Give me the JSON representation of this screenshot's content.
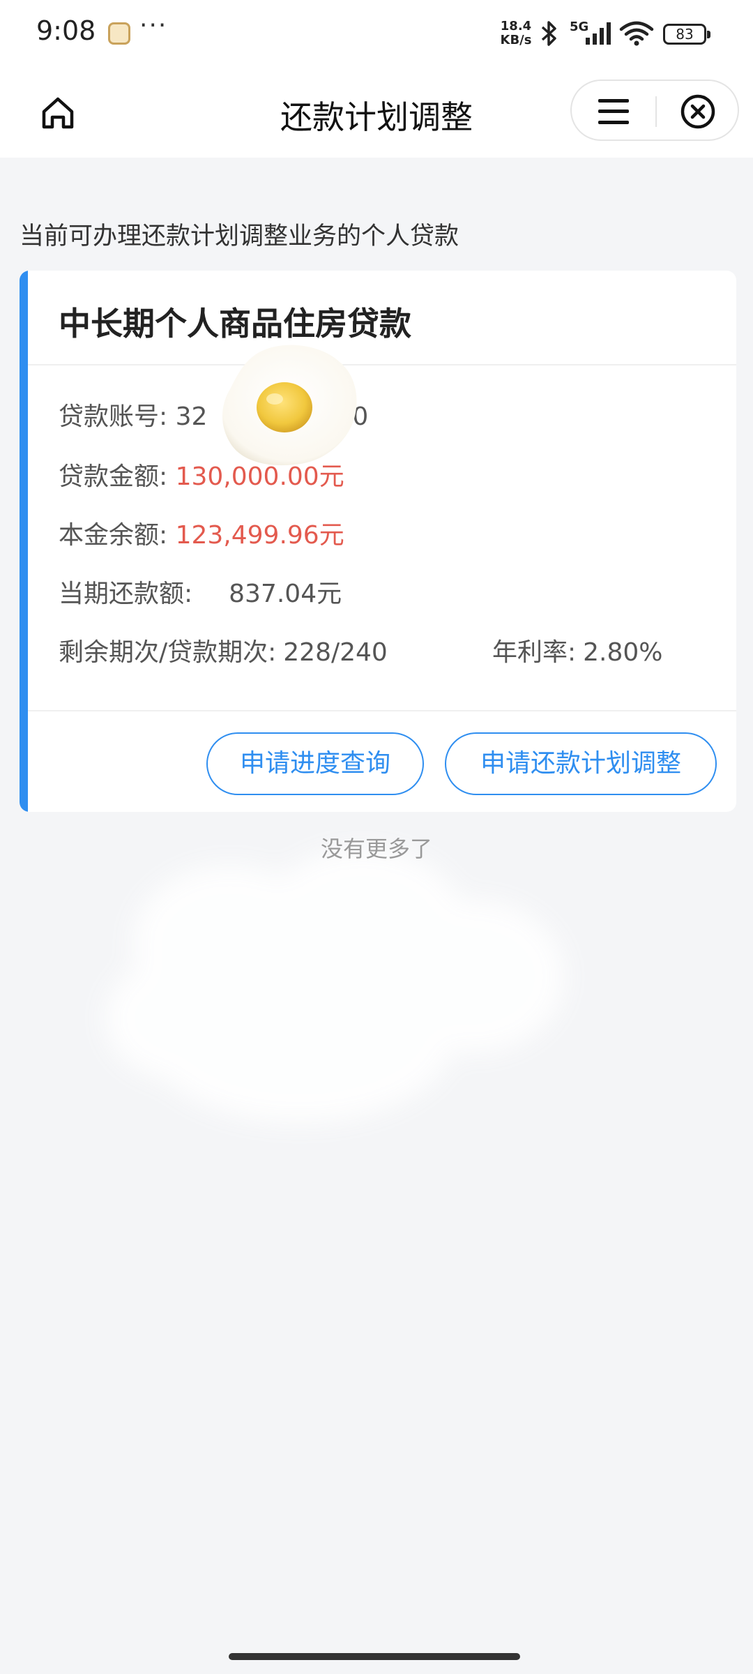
{
  "status_bar": {
    "time": "9:08",
    "more": "···",
    "net_speed_value": "18.4",
    "net_speed_unit": "KB/s",
    "network": "5G",
    "battery": "83"
  },
  "nav": {
    "title": "还款计划调整",
    "icons": {
      "home": "home-icon",
      "menu": "menu-icon",
      "close": "close-circle-icon"
    }
  },
  "section_title": "当前可办理还款计划调整业务的个人贷款",
  "loan_card": {
    "title": "中长期个人商品住房贷款",
    "account_label": "贷款账号:",
    "account_value_start": "32",
    "account_value_end": "0",
    "amount_label": "贷款金额:",
    "amount_value": "130,000.00元",
    "principal_label": "本金余额:",
    "principal_value": "123,499.96元",
    "current_payment_label": "当期还款额:",
    "current_payment_value": "837.04元",
    "periods_label": "剩余期次/贷款期次:",
    "periods_value": "228/240",
    "rate_label": "年利率:",
    "rate_value": "2.80%",
    "accent_color": "#2f8ef0",
    "highlight_color": "#e35a4e"
  },
  "buttons": {
    "progress_query": "申请进度查询",
    "plan_adjust": "申请还款计划调整"
  },
  "footer_text": "没有更多了"
}
